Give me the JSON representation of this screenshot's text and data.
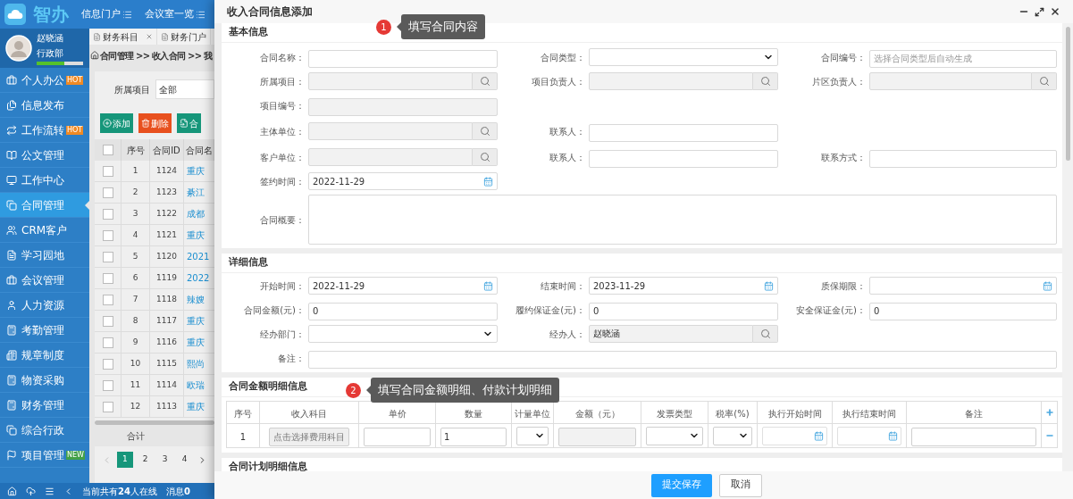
{
  "app": {
    "logo_text": "智办"
  },
  "top_nav": [
    {
      "label": "信息门户"
    },
    {
      "label": "会议室一览"
    }
  ],
  "user": {
    "name": "赵晓涵",
    "department": "行政部",
    "level": 0.6
  },
  "sidebar": {
    "items": [
      {
        "label": "个人办公",
        "badge": {
          "text": "HOT",
          "color": "#f08a24"
        },
        "selected": false
      },
      {
        "label": "信息发布",
        "selected": false
      },
      {
        "label": "工作流转",
        "badge": {
          "text": "HOT",
          "color": "#f08a24"
        },
        "selected": false
      },
      {
        "label": "公文管理",
        "selected": false
      },
      {
        "label": "工作中心",
        "selected": false
      },
      {
        "label": "合同管理",
        "selected": true
      },
      {
        "label": "CRM客户",
        "selected": false
      },
      {
        "label": "学习园地",
        "selected": false
      },
      {
        "label": "会议管理",
        "selected": false
      },
      {
        "label": "人力资源",
        "selected": false
      },
      {
        "label": "考勤管理",
        "selected": false
      },
      {
        "label": "规章制度",
        "selected": false
      },
      {
        "label": "物资采购",
        "selected": false
      },
      {
        "label": "财务管理",
        "selected": false
      },
      {
        "label": "综合行政",
        "selected": false
      },
      {
        "label": "项目管理",
        "badge": {
          "text": "NEW",
          "color": "#43a047"
        },
        "selected": false
      }
    ]
  },
  "tabs": [
    {
      "label": "财务科目",
      "closable": true
    },
    {
      "label": "财务门户",
      "closable": false
    }
  ],
  "breadcrumb": "合同管理 >> 收入合同 >> 我",
  "filter": {
    "label": "所属项目",
    "value": "全部"
  },
  "toolbar": [
    {
      "label": "添加",
      "kind": "add"
    },
    {
      "label": "删除",
      "kind": "delete"
    },
    {
      "label": "合",
      "kind": "import"
    }
  ],
  "contract_table": {
    "all_checked": false,
    "columns": [
      "序号",
      "合同ID",
      "合同名"
    ],
    "rows": [
      {
        "index": "1",
        "id": "1124",
        "name": "重庆",
        "checked": false
      },
      {
        "index": "2",
        "id": "1123",
        "name": "綦江",
        "checked": false
      },
      {
        "index": "3",
        "id": "1122",
        "name": "成都",
        "checked": false
      },
      {
        "index": "4",
        "id": "1121",
        "name": "重庆",
        "checked": false
      },
      {
        "index": "5",
        "id": "1120",
        "name": "2021",
        "checked": false
      },
      {
        "index": "6",
        "id": "1119",
        "name": "2022",
        "checked": false
      },
      {
        "index": "7",
        "id": "1118",
        "name": "辣嫂",
        "checked": false
      },
      {
        "index": "8",
        "id": "1117",
        "name": "重庆",
        "checked": false
      },
      {
        "index": "9",
        "id": "1116",
        "name": "重庆",
        "checked": false
      },
      {
        "index": "10",
        "id": "1115",
        "name": "熙尚",
        "checked": false
      },
      {
        "index": "11",
        "id": "1114",
        "name": "欧瑞",
        "checked": false
      },
      {
        "index": "12",
        "id": "1113",
        "name": "重庆",
        "checked": false
      }
    ],
    "total_label": "合计"
  },
  "pagination": [
    {
      "label": "1",
      "selected": true
    },
    {
      "label": "2",
      "selected": false
    },
    {
      "label": "3",
      "selected": false
    },
    {
      "label": "4",
      "selected": false
    }
  ],
  "status_bar": {
    "online": "当前共有**24**人在线",
    "messages": "消息**0**"
  },
  "dialog": {
    "title": "收入合同信息添加",
    "basic_info": {
      "title": "基本信息",
      "callout": {
        "number": "1",
        "text": "填写合同内容"
      },
      "rows": [
        [
          {
            "label": "合同名称：",
            "kind": "text"
          },
          {
            "label": "合同类型：",
            "kind": "select"
          },
          {
            "label": "合同编号：",
            "kind": "text",
            "placeholder": "选择合同类型后自动生成"
          }
        ],
        [
          {
            "label": "所属项目：",
            "kind": "lookup"
          },
          {
            "label": "项目负责人：",
            "kind": "lookup"
          },
          {
            "label": "片区负责人：",
            "kind": "lookup"
          }
        ],
        [
          {
            "label": "项目编号：",
            "kind": "readonly"
          }
        ],
        [
          {
            "label": "主体单位：",
            "kind": "lookup"
          },
          {
            "label": "联系人：",
            "kind": "text"
          }
        ],
        [
          {
            "label": "客户单位：",
            "kind": "lookup"
          },
          {
            "label": "联系人：",
            "kind": "text"
          },
          {
            "label": "联系方式：",
            "kind": "text"
          }
        ],
        [
          {
            "label": "签约时间：",
            "kind": "date",
            "value": "2022-11-29"
          }
        ],
        [
          {
            "label": "合同概要：",
            "kind": "textarea"
          }
        ]
      ]
    },
    "detail_info": {
      "title": "详细信息",
      "rows": [
        [
          {
            "label": "开始时间：",
            "kind": "date",
            "value": "2022-11-29"
          },
          {
            "label": "结束时间：",
            "kind": "date",
            "value": "2023-11-29"
          },
          {
            "label": "质保期限：",
            "kind": "date"
          }
        ],
        [
          {
            "label": "合同金额(元)：",
            "kind": "text",
            "value": "0"
          },
          {
            "label": "履约保证金(元)：",
            "kind": "text",
            "value": "0"
          },
          {
            "label": "安全保证金(元)：",
            "kind": "text",
            "value": "0"
          }
        ],
        [
          {
            "label": "经办部门：",
            "kind": "select"
          },
          {
            "label": "经办人：",
            "kind": "lookup",
            "value": "赵晓涵"
          }
        ],
        [
          {
            "label": "备注：",
            "kind": "longtext"
          }
        ]
      ]
    },
    "amount_detail": {
      "title": "合同金额明细信息",
      "callout": {
        "number": "2",
        "text": "填写合同金额明细、付款计划明细"
      },
      "columns": [
        "序号",
        "收入科目",
        "单价",
        "数量",
        "计量单位",
        "金额（元）",
        "发票类型",
        "税率(%)",
        "执行开始时间",
        "执行结束时间",
        "备注"
      ],
      "rows": [
        {
          "cells": [
            {
              "kind": "text",
              "value": "1"
            },
            {
              "kind": "picker",
              "label": "点击选择费用科目"
            },
            {
              "kind": "input"
            },
            {
              "kind": "input",
              "value": "1"
            },
            {
              "kind": "select"
            },
            {
              "kind": "readonly"
            },
            {
              "kind": "select"
            },
            {
              "kind": "select"
            },
            {
              "kind": "date"
            },
            {
              "kind": "date"
            },
            {
              "kind": "input"
            }
          ]
        }
      ]
    },
    "plan_detail": {
      "title": "合同计划明细信息"
    },
    "buttons": [
      {
        "label": "提交保存",
        "kind": "primary"
      },
      {
        "label": "取消",
        "kind": "default"
      }
    ]
  }
}
